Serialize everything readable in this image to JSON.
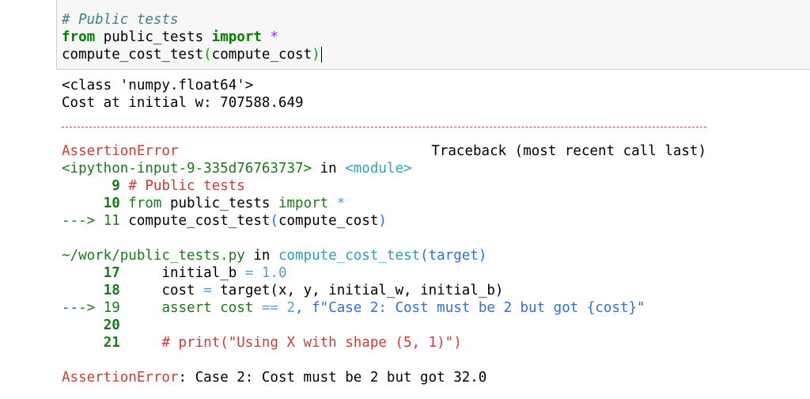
{
  "input_cell": {
    "line1_comment": "# Public tests",
    "line2_from": "from",
    "line2_module": " public_tests ",
    "line2_import": "import",
    "line2_star": " *",
    "line3_func": "compute_cost_test",
    "line3_open": "(",
    "line3_arg": "compute_cost",
    "line3_close": ")"
  },
  "output": {
    "stdout_line1": "<class 'numpy.float64'>",
    "stdout_line2": "Cost at initial w: 707588.649",
    "error_name": "AssertionError",
    "traceback_header": "Traceback (most recent call last)",
    "frame1_file": "<ipython-input-9-335d76763737>",
    "frame1_in": " in ",
    "frame1_module": "<module>",
    "frame1_lines": [
      {
        "arrow": "      ",
        "num": "9",
        "code_comment": " # Public tests"
      },
      {
        "arrow": "     ",
        "num": "10",
        "code_kw": " from",
        "code_rest": " public_tests ",
        "code_kw2": "import",
        "code_star": " *"
      },
      {
        "arrow": "---> ",
        "num": "11",
        "code_rest": " compute_cost_test",
        "code_paren": "(",
        "code_arg": "compute_cost",
        "code_paren2": ")"
      }
    ],
    "frame2_file": "~/work/public_tests.py",
    "frame2_in": " in ",
    "frame2_func": "compute_cost_test",
    "frame2_arg": "(target)",
    "frame2_lines": [
      {
        "arrow": "     ",
        "num": "17",
        "code": "     initial_b ",
        "op": "=",
        "val": " 1.0"
      },
      {
        "arrow": "     ",
        "num": "18",
        "code": "     cost ",
        "op": "=",
        "code2": " target(x, y, initial_w, initial_b)"
      },
      {
        "arrow": "---> ",
        "num": "19",
        "code": "     assert cost ",
        "op": "==",
        "val": " 2",
        "code2": ", f\"Case 2: Cost must be 2 but got {cost}\""
      },
      {
        "arrow": "     ",
        "num": "20",
        "code": ""
      },
      {
        "arrow": "     ",
        "num": "21",
        "code": "     # print(\"Using X with shape (5, 1)\")"
      }
    ],
    "final_error_name": "AssertionError",
    "final_error_msg": ": Case 2: Cost must be 2 but got 32.0"
  }
}
